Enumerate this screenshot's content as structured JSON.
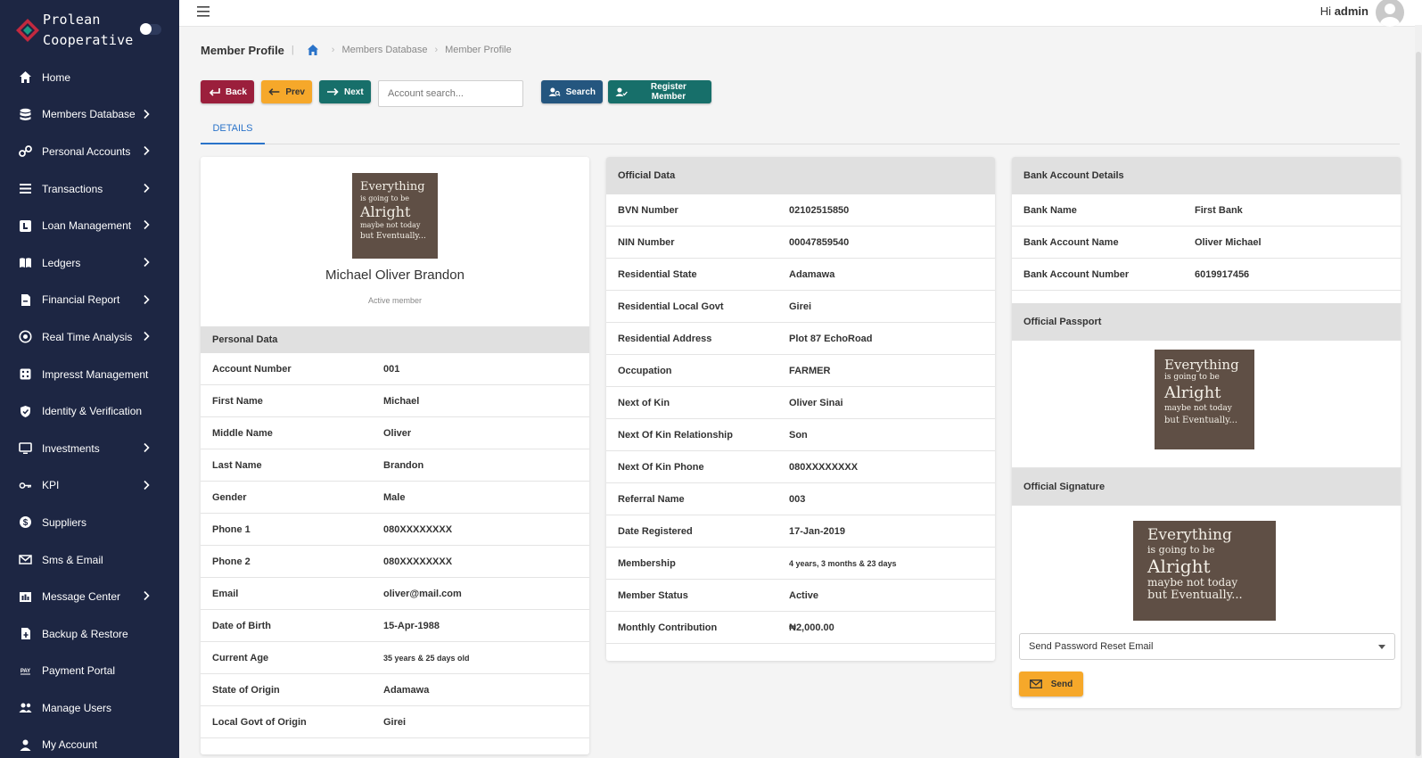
{
  "brand": {
    "name_line1": "Prolean",
    "name_line2": "Cooperative"
  },
  "sidebar": {
    "items": [
      {
        "label": "Home",
        "icon": "home-icon",
        "chevron": false
      },
      {
        "label": "Members Database",
        "icon": "database-icon",
        "chevron": true
      },
      {
        "label": "Personal Accounts",
        "icon": "link-icon",
        "chevron": true
      },
      {
        "label": "Transactions",
        "icon": "transactions-icon",
        "chevron": true
      },
      {
        "label": "Loan Management",
        "icon": "loan-icon",
        "chevron": true
      },
      {
        "label": "Ledgers",
        "icon": "book-icon",
        "chevron": true
      },
      {
        "label": "Financial Report",
        "icon": "report-icon",
        "chevron": true
      },
      {
        "label": "Real Time Analysis",
        "icon": "analysis-icon",
        "chevron": true
      },
      {
        "label": "Impresst Management",
        "icon": "dice-icon",
        "chevron": false
      },
      {
        "label": "Identity & Verification",
        "icon": "shield-icon",
        "chevron": false
      },
      {
        "label": "Investments",
        "icon": "monitor-icon",
        "chevron": true
      },
      {
        "label": "KPI",
        "icon": "key-icon",
        "chevron": true
      },
      {
        "label": "Suppliers",
        "icon": "dollar-icon",
        "chevron": false
      },
      {
        "label": "Sms & Email",
        "icon": "mail-icon",
        "chevron": false
      },
      {
        "label": "Message Center",
        "icon": "message-icon",
        "chevron": true
      },
      {
        "label": "Backup & Restore",
        "icon": "backup-icon",
        "chevron": false
      },
      {
        "label": "Payment Portal",
        "icon": "pay-icon",
        "chevron": false
      },
      {
        "label": "Manage Users",
        "icon": "users-icon",
        "chevron": false
      },
      {
        "label": "My Account",
        "icon": "user-icon",
        "chevron": false
      }
    ]
  },
  "topbar": {
    "greeting": "Hi",
    "username": "admin"
  },
  "breadcrumb": {
    "title": "Member Profile",
    "items": [
      "Members Database",
      "Member Profile"
    ]
  },
  "toolbar": {
    "back": "Back",
    "prev": "Prev",
    "next": "Next",
    "search_placeholder": "Account search...",
    "search": "Search",
    "register": "Register Member"
  },
  "tabs": {
    "details": "DETAILS"
  },
  "profile": {
    "name": "Michael Oliver Brandon",
    "status": "Active member",
    "photo_text": [
      "Everything",
      "is going to be",
      "Alright",
      "maybe not today",
      "but Eventually..."
    ]
  },
  "personal": {
    "title": "Personal Data",
    "rows": [
      {
        "k": "Account Number",
        "v": "001"
      },
      {
        "k": "First Name",
        "v": "Michael"
      },
      {
        "k": "Middle Name",
        "v": "Oliver"
      },
      {
        "k": "Last Name",
        "v": "Brandon"
      },
      {
        "k": "Gender",
        "v": "Male"
      },
      {
        "k": "Phone 1",
        "v": "080XXXXXXXX"
      },
      {
        "k": "Phone 2",
        "v": "080XXXXXXXX"
      },
      {
        "k": "Email",
        "v": "oliver@mail.com"
      },
      {
        "k": "Date of Birth",
        "v": "15-Apr-1988"
      },
      {
        "k": "Current Age",
        "v": "35 years & 25 days old",
        "small": true
      },
      {
        "k": "State of Origin",
        "v": "Adamawa"
      },
      {
        "k": "Local Govt of Origin",
        "v": "Girei"
      }
    ]
  },
  "official": {
    "title": "Official Data",
    "rows": [
      {
        "k": "BVN Number",
        "v": "02102515850"
      },
      {
        "k": "NIN Number",
        "v": "00047859540"
      },
      {
        "k": "Residential State",
        "v": "Adamawa"
      },
      {
        "k": "Residential Local Govt",
        "v": "Girei"
      },
      {
        "k": "Residential Address",
        "v": "Plot 87 EchoRoad"
      },
      {
        "k": "Occupation",
        "v": "FARMER"
      },
      {
        "k": "Next of Kin",
        "v": "Oliver Sinai"
      },
      {
        "k": "Next Of Kin Relationship",
        "v": "Son"
      },
      {
        "k": "Next Of Kin Phone",
        "v": "080XXXXXXXX"
      },
      {
        "k": "Referral Name",
        "v": "003"
      },
      {
        "k": "Date Registered",
        "v": "17-Jan-2019"
      },
      {
        "k": "Membership",
        "v": "4 years, 3 months & 23 days",
        "small": true
      },
      {
        "k": "Member Status",
        "v": "Active"
      },
      {
        "k": "Monthly Contribution",
        "v": "₦2,000.00"
      }
    ]
  },
  "bank": {
    "title": "Bank Account Details",
    "rows": [
      {
        "k": "Bank Name",
        "v": "First Bank"
      },
      {
        "k": "Bank Account Name",
        "v": "Oliver Michael"
      },
      {
        "k": "Bank Account Number",
        "v": "6019917456"
      }
    ],
    "passport_title": "Official Passport",
    "signature_title": "Official Signature",
    "reset_select": "Send Password Reset Email",
    "send": "Send"
  },
  "colors": {
    "sidebar": "#1d2643",
    "back": "#9b1f3c",
    "prev": "#f6a82a",
    "next": "#176f6a",
    "search": "#24567f",
    "tab_active": "#2a73c9"
  }
}
